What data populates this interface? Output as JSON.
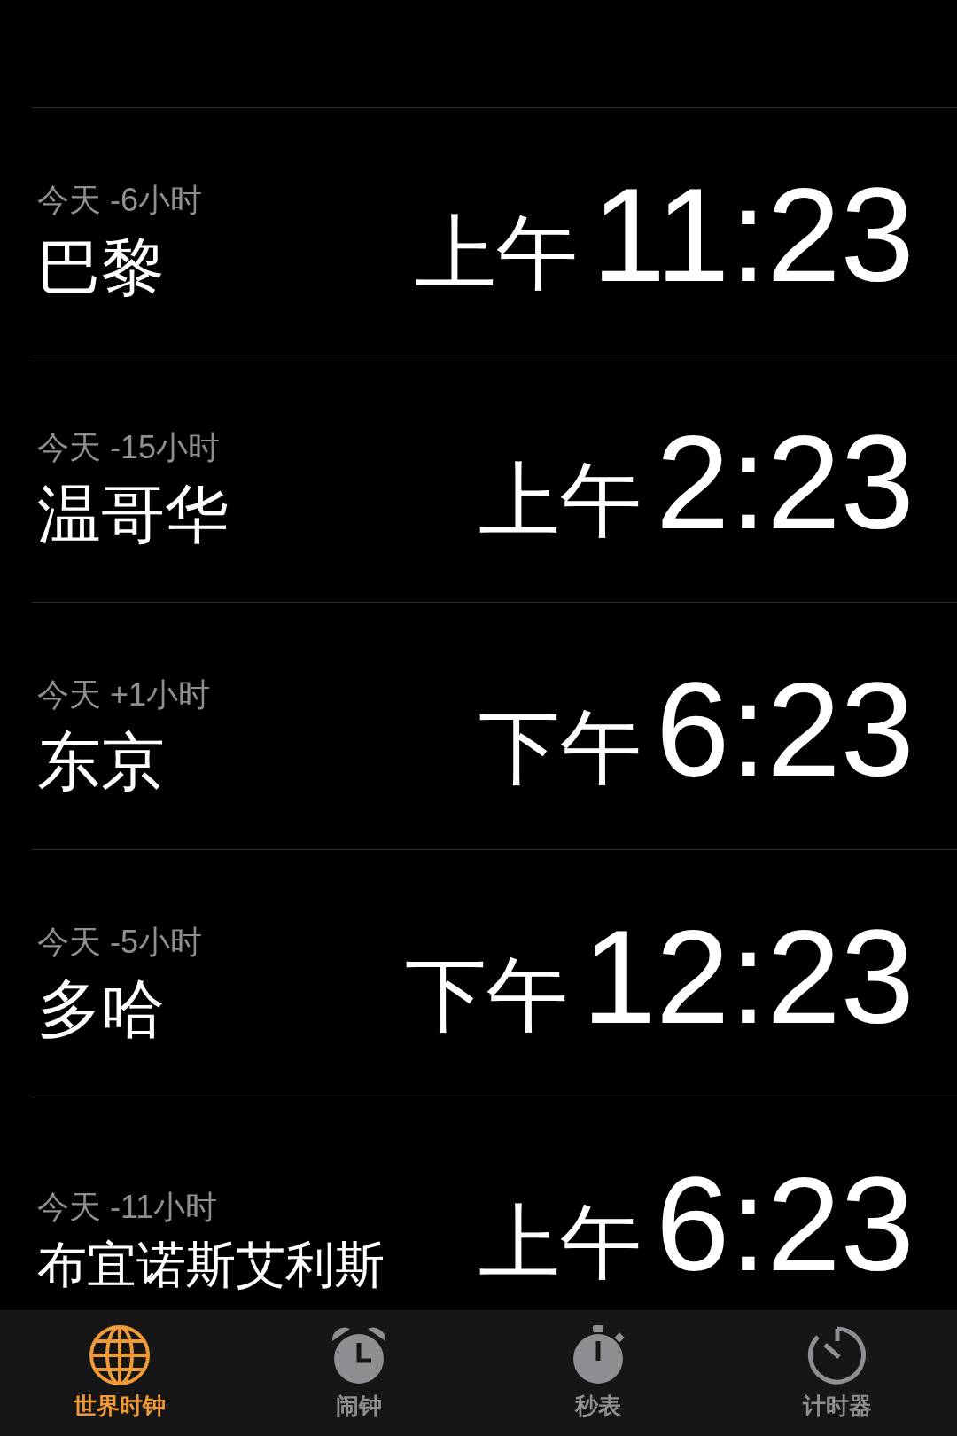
{
  "clocks": [
    {
      "offset": "今天 -6小时",
      "city": "巴黎",
      "ampm": "上午",
      "time": "11:23"
    },
    {
      "offset": "今天 -15小时",
      "city": "温哥华",
      "ampm": "上午",
      "time": "2:23"
    },
    {
      "offset": "今天 +1小时",
      "city": "东京",
      "ampm": "下午",
      "time": "6:23"
    },
    {
      "offset": "今天 -5小时",
      "city": "多哈",
      "ampm": "下午",
      "time": "12:23"
    },
    {
      "offset": "今天 -11小时",
      "city": "布宜诺斯艾利斯",
      "ampm": "上午",
      "time": "6:23"
    }
  ],
  "tabs": [
    {
      "label": "世界时钟",
      "selected": true
    },
    {
      "label": "闹钟",
      "selected": false
    },
    {
      "label": "秒表",
      "selected": false
    },
    {
      "label": "计时器",
      "selected": false
    }
  ]
}
